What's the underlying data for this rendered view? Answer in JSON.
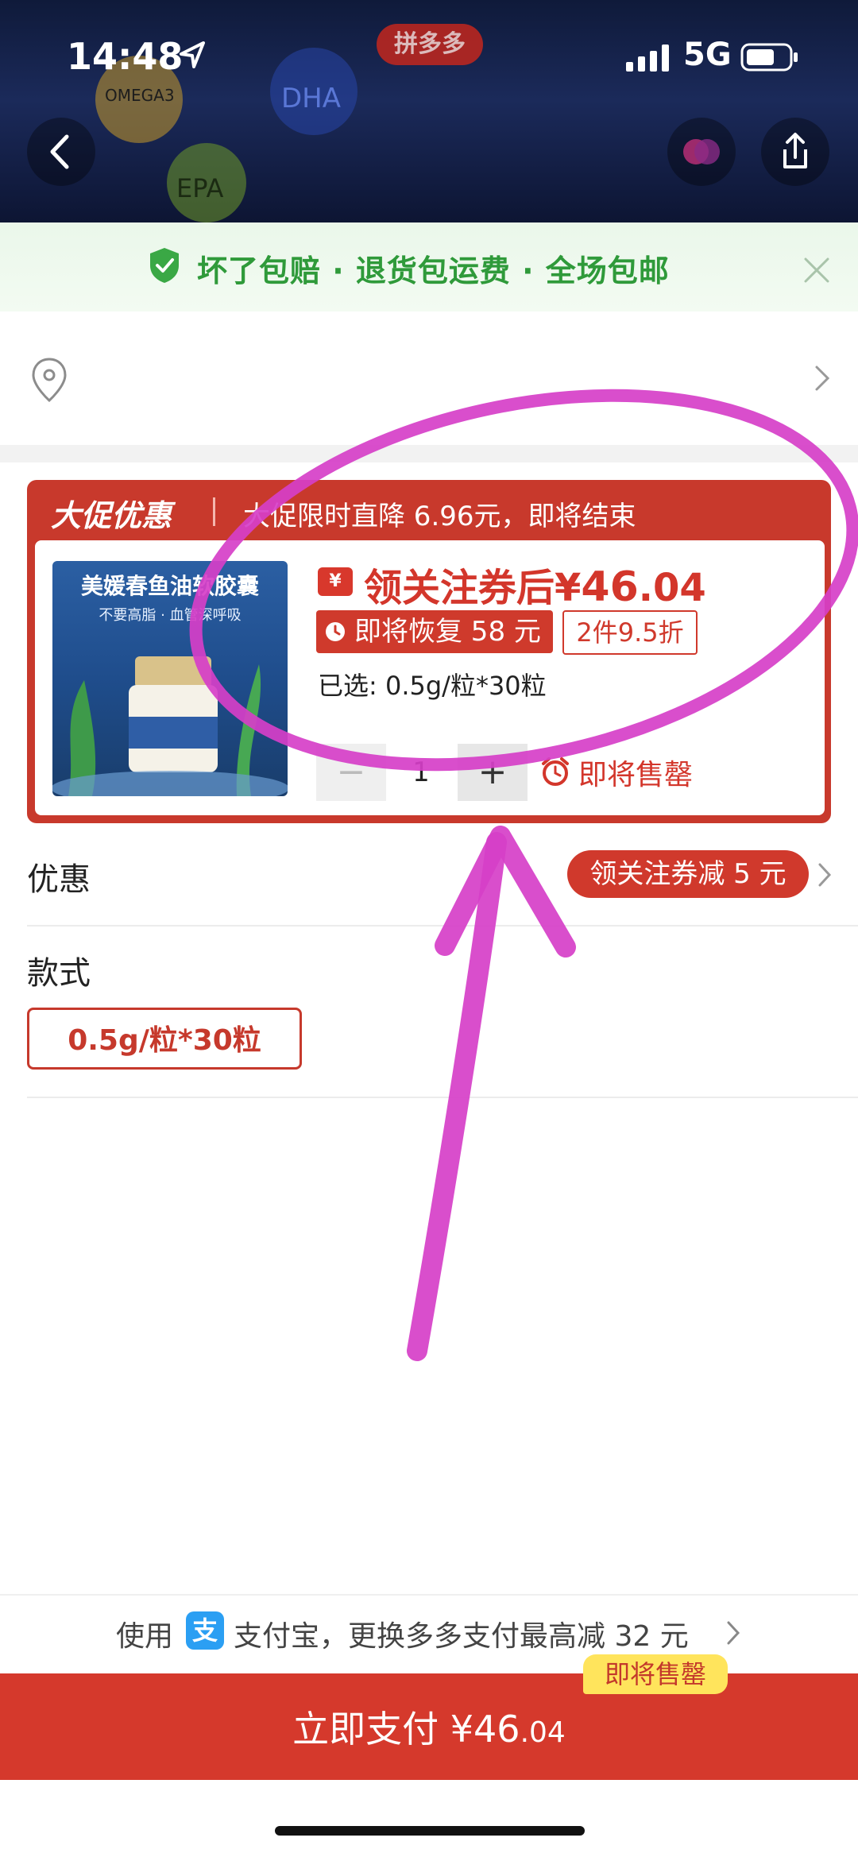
{
  "status_bar": {
    "time": "14:48",
    "network": "5G",
    "brand_tag": "拼多多"
  },
  "header_bubbles": [
    "OMEGA3",
    "DHA",
    "EPA"
  ],
  "guarantee_banner": {
    "text": "坏了包赔 · 退货包运费 · 全场包邮"
  },
  "promo": {
    "badge": "大促优惠",
    "line": "大促限时直降 6.96元，即将结束",
    "coupon_symbol": "¥",
    "price_prefix": "领关注券后¥",
    "price_int": "46",
    "price_dec": ".04",
    "restore_text": "即将恢复 58 元",
    "discount_text": "2件9.5折",
    "selected_text": "已选: 0.5g/粒*30粒",
    "quantity": "1",
    "minus": "−",
    "plus": "+",
    "sellout_text": "即将售罄",
    "product_image_title": "美媛春鱼油软胶囊",
    "product_image_sub": "不要高脂 · 血管深呼吸"
  },
  "offers": {
    "label": "优惠",
    "pill": "领关注券减 5 元"
  },
  "style": {
    "label": "款式",
    "option": "0.5g/粒*30粒"
  },
  "pay_switch": {
    "prefix": "使用",
    "alipay_glyph": "支",
    "text": "支付宝，更换多多支付最高减 32 元"
  },
  "pay_bar": {
    "label": "立即支付 ¥46",
    "cents": ".04",
    "sellout_chip": "即将售罄"
  },
  "colors": {
    "accent_red": "#d5392c",
    "guarantee_green": "#2f9a3a",
    "annotation_magenta": "#d63fc8"
  }
}
